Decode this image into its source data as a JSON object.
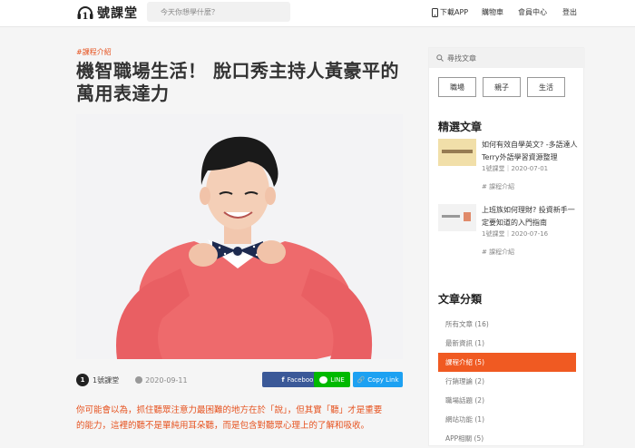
{
  "header": {
    "logo_text": "號課堂",
    "logo_numeral": "1",
    "search_placeholder": "今天你想學什麼？",
    "nav": {
      "app_label": "下載APP",
      "cart_label": "購物車",
      "member_label": "會員中心",
      "logout_label": "登出"
    }
  },
  "article": {
    "category_tag": "#課程介紹",
    "title_line1": "機智職場生活！ 脫口秀主持人黃豪平的",
    "title_line2": "萬用表達力",
    "author": "1號課堂",
    "author_avatar_text": "1",
    "date": "2020-09-11",
    "share": {
      "facebook": "Facebook",
      "line": "LINE",
      "copy": "Copy Link"
    },
    "lead_line1": "你可能會以為，抓住聽眾注意力最困難的地方在於「說」，但其實「聽」才是重要",
    "lead_line2": "的能力，這裡的聽不是單純用耳朵聽，而是包含對聽眾心理上的了解和吸收。"
  },
  "sidebar": {
    "search_placeholder": "尋找文章",
    "tags": [
      "職場",
      "親子",
      "生活"
    ],
    "featured_heading": "精選文章",
    "featured": [
      {
        "title": "如何有效自學英文? -多語達人Terry外語學習資源整理",
        "meta": "1號課堂｜2020-07-01",
        "tag": "# 課程介紹"
      },
      {
        "title": "上班族如何理財? 投資新手一定要知道的入門指南",
        "meta": "1號課堂｜2020-07-16",
        "tag": "# 課程介紹"
      }
    ],
    "categories_heading": "文章分類",
    "categories": [
      "所有文章 (16)",
      "最新資訊 (1)",
      "課程介紹 (5)",
      "行銷理論 (2)",
      "職場話題 (2)",
      "網站功能 (1)",
      "APP相關 (5)"
    ],
    "active_category_index": 2
  },
  "colors": {
    "accent": "#e6521f",
    "facebook": "#3b5998",
    "line": "#00b900",
    "copy": "#1da1f2"
  }
}
